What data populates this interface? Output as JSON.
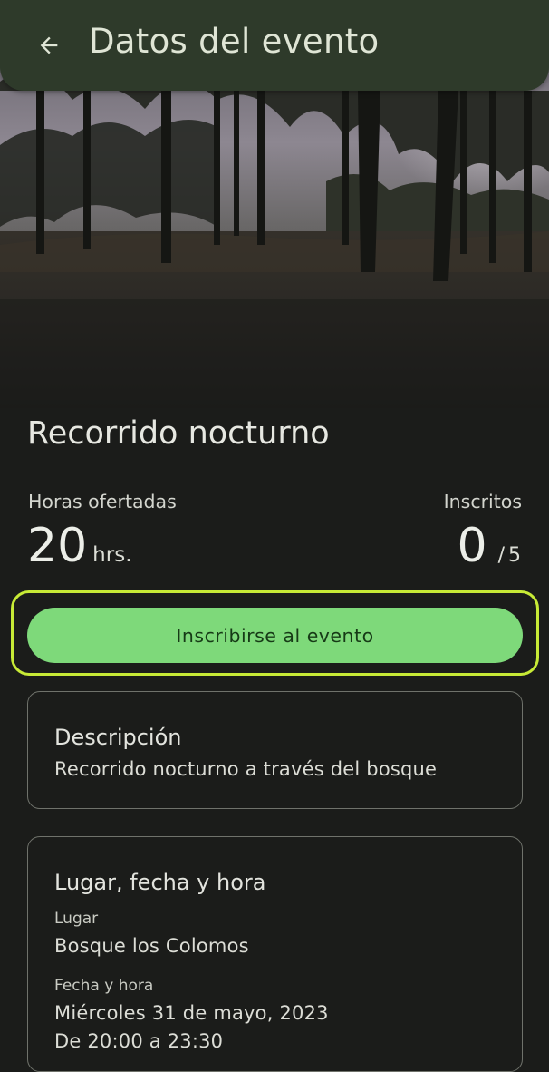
{
  "app_bar": {
    "title": "Datos del evento",
    "back_icon": "arrow-back-icon",
    "color": "#2e3a2a"
  },
  "hero": {
    "icon": "forest-photo"
  },
  "event": {
    "title": "Recorrido nocturno",
    "hours_label": "Horas ofertadas",
    "hours_value": "20",
    "hours_unit": "hrs.",
    "enrolled_label": "Inscritos",
    "enrolled_value": "0",
    "enrolled_separator": "/",
    "enrolled_capacity": "5"
  },
  "cta": {
    "label": "Inscribirse al evento",
    "color": "#7ed97a",
    "focus_color": "#c7ea36"
  },
  "description_card": {
    "title": "Descripción",
    "text": "Recorrido nocturno a través del bosque"
  },
  "place_card": {
    "title": "Lugar, fecha y hora",
    "place_label": "Lugar",
    "place_value": "Bosque los Colomos",
    "datetime_label": "Fecha y hora",
    "date_value": "Miércoles 31 de mayo, 2023",
    "time_value": "De 20:00 a 23:30"
  }
}
